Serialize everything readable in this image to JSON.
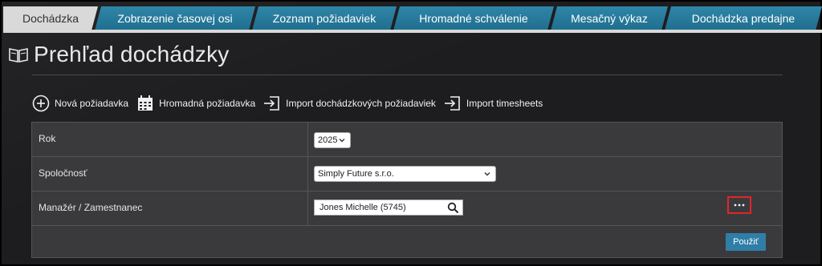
{
  "tabs": [
    {
      "label": "Dochádzka",
      "active": true
    },
    {
      "label": "Zobrazenie časovej osi",
      "active": false
    },
    {
      "label": "Zoznam požiadaviek",
      "active": false
    },
    {
      "label": "Hromadné schválenie",
      "active": false
    },
    {
      "label": "Mesačný výkaz",
      "active": false
    },
    {
      "label": "Dochádzka predajne",
      "active": false
    }
  ],
  "page": {
    "title": "Prehľad dochádzky",
    "title_icon": "book-icon"
  },
  "toolbar": {
    "new_request": "Nová požiadavka",
    "bulk_request": "Hromadná požiadavka",
    "import_requests": "Import dochádzkových požiadaviek",
    "import_timesheets": "Import timesheets"
  },
  "form": {
    "year_label": "Rok",
    "year_value": "2025",
    "company_label": "Spoločnosť",
    "company_value": "Simply Future s.r.o.",
    "manager_label": "Manažér / Zamestnanec",
    "manager_value": "Jones Michelle (5745)",
    "more_label": "...",
    "apply_label": "Použiť"
  },
  "colors": {
    "tab": "#2f86a8",
    "active_tab": "#d9d9d9",
    "apply": "#2f7ea8",
    "highlight": "#e0262a"
  }
}
